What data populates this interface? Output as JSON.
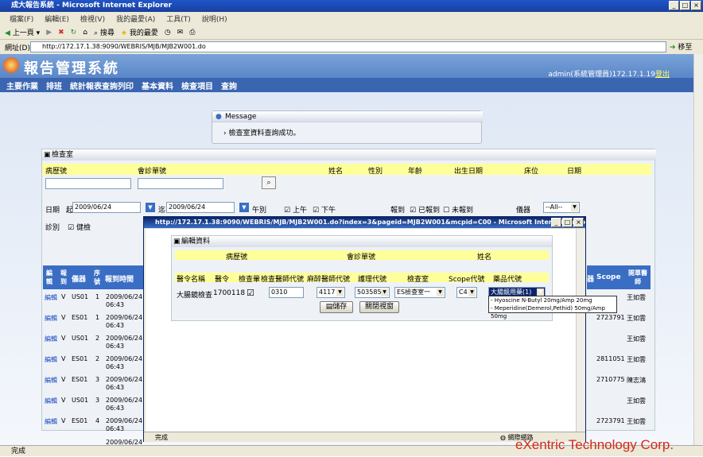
{
  "window": {
    "title": "成大報告系統 - Microsoft Internet Explorer"
  },
  "menu": [
    "檔案(F)",
    "編輯(E)",
    "檢視(V)",
    "我的最愛(A)",
    "工具(T)",
    "說明(H)"
  ],
  "toolbar": {
    "back": "上一頁",
    "search": "搜尋",
    "favorites": "我的最愛"
  },
  "address": {
    "label": "網址(D)",
    "url": "http://172.17.1.38:9090/WEBRIS/MJB/MJB2W001.do",
    "go": "移至"
  },
  "app": {
    "title": "報告管理系統",
    "user": "admin(系統管理員)172.17.1.19",
    "logout": "登出",
    "nav": [
      "主要作業",
      "排班",
      "統計報表查詢列印",
      "基本資料",
      "檢查項目",
      "查詢"
    ]
  },
  "message": {
    "title": "Message",
    "text": "檢查室資料查詢成功。"
  },
  "panel": {
    "title": "檢查室",
    "headers": [
      "病歷號",
      "會診單號",
      "姓名",
      "性別",
      "年齡",
      "出生日期",
      "床位",
      "日期"
    ],
    "date_label": "日期",
    "date_from_prefix": "起",
    "date_from": "2009/06/24",
    "date_to_prefix": "迄",
    "date_to": "2009/06/24",
    "shift_label": "午別",
    "am": "上午",
    "pm": "下午",
    "report_label": "報到",
    "reported": "已報到",
    "not_reported": "未報到",
    "device_label": "儀器",
    "device_value": "--All--",
    "diag_label": "診別",
    "health": "健檢"
  },
  "list": {
    "headers": [
      "編輯",
      "報到",
      "儀器",
      "序號",
      "報到時間"
    ],
    "right_headers": [
      "器",
      "Scope",
      "開單醫師"
    ],
    "rows": [
      {
        "edit": "編輯",
        "flag": "V",
        "dev": "US01",
        "seq": "1",
        "date": "2009/06/24",
        "time": "06:43",
        "scope": "",
        "doc": "王如雲"
      },
      {
        "edit": "編輯",
        "flag": "V",
        "dev": "ES01",
        "seq": "1",
        "date": "2009/06/24",
        "time": "06:43",
        "scope": "2723791",
        "doc": "王如雲"
      },
      {
        "edit": "編輯",
        "flag": "V",
        "dev": "US01",
        "seq": "2",
        "date": "2009/06/24",
        "time": "06:43",
        "scope": "",
        "doc": "王如雲"
      },
      {
        "edit": "編輯",
        "flag": "V",
        "dev": "ES01",
        "seq": "2",
        "date": "2009/06/24",
        "time": "06:43",
        "scope": "2811051",
        "doc": "王如雲"
      },
      {
        "edit": "編輯",
        "flag": "V",
        "dev": "ES01",
        "seq": "3",
        "date": "2009/06/24",
        "time": "06:43",
        "scope": "2710775",
        "doc": "陳志鴻"
      },
      {
        "edit": "編輯",
        "flag": "V",
        "dev": "US01",
        "seq": "3",
        "date": "2009/06/24",
        "time": "06:43",
        "scope": "",
        "doc": "王如雲"
      },
      {
        "edit": "編輯",
        "flag": "V",
        "dev": "ES01",
        "seq": "4",
        "date": "2009/06/24",
        "time": "06:43",
        "scope": "2723791",
        "doc": "王如雲"
      }
    ],
    "partial_date": "2009/06/24"
  },
  "popup": {
    "title": "http://172.17.1.38:9090/WEBRIS/MJB/MJB2W001.do?index=3&pageid=MJB2W001&mcpid=C00 - Microsoft Internet Explorer",
    "panel_title": "編輯資料",
    "top_headers": [
      "病歷號",
      "會診單號",
      "姓名"
    ],
    "cols": [
      "醫令名稱",
      "醫令",
      "檢查暈",
      "檢查醫師代號",
      "麻醉醫師代號",
      "護理代號",
      "檢查室",
      "Scope代號",
      "藥品代號"
    ],
    "order_name": "大腸鏡檢查",
    "order_code": "1700118",
    "doctor_code": "0310",
    "anesth": "4117",
    "nurse": "503585",
    "room": "ES檢查室一",
    "scope": "C4",
    "drug": "大腸鏡用藥(1)",
    "save": "儲存",
    "close": "關閉視窗",
    "status": "完成",
    "zone": "網際網路"
  },
  "dropdown_options": [
    "- Hyoscine N-Butyl  20mg/Amp 20mg",
    "- Meperidine(Demerol,Pethid)  50mg/Amp 50mg"
  ],
  "status": "完成",
  "watermark": "eXentric Technology Corp."
}
